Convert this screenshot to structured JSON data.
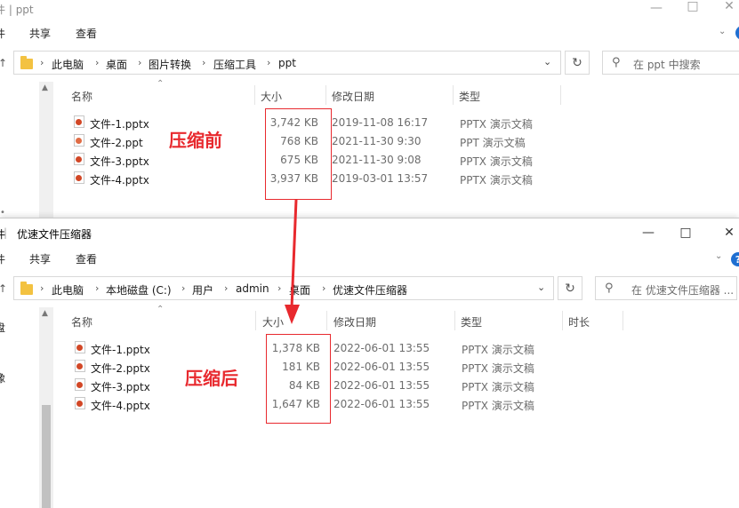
{
  "top_window": {
    "title": "ppt",
    "ribbon_tabs": [
      "件",
      "共享",
      "查看"
    ],
    "breadcrumb": [
      "此电脑",
      "桌面",
      "图片转换",
      "压缩工具",
      "ppt"
    ],
    "search_placeholder": "在 ppt 中搜索",
    "columns": [
      "名称",
      "大小",
      "修改日期",
      "类型"
    ],
    "files": [
      {
        "name": "文件-1.pptx",
        "size": "3,742 KB",
        "date": "2019-11-08 16:17",
        "type": "PPTX 演示文稿",
        "icon": "pptx-file-icon"
      },
      {
        "name": "文件-2.ppt",
        "size": "768 KB",
        "date": "2021-11-30 9:30",
        "type": "PPT 演示文稿",
        "icon": "ppt-file-icon"
      },
      {
        "name": "文件-3.pptx",
        "size": "675 KB",
        "date": "2021-11-30 9:08",
        "type": "PPTX 演示文稿",
        "icon": "pptx-file-icon"
      },
      {
        "name": "文件-4.pptx",
        "size": "3,937 KB",
        "date": "2019-03-01 13:57",
        "type": "PPTX 演示文稿",
        "icon": "pptx-file-icon"
      }
    ],
    "annotation": "压缩前"
  },
  "bottom_window": {
    "title": "优速文件压缩器",
    "title_prefix": "件",
    "ribbon_tabs": [
      "件",
      "共享",
      "查看"
    ],
    "breadcrumb": [
      "此电脑",
      "本地磁盘 (C:)",
      "用户",
      "admin",
      "桌面",
      "优速文件压缩器"
    ],
    "search_placeholder": "在 优速文件压缩器 ...",
    "columns": [
      "名称",
      "大小",
      "修改日期",
      "类型",
      "时长"
    ],
    "files": [
      {
        "name": "文件-1.pptx",
        "size": "1,378 KB",
        "date": "2022-06-01 13:55",
        "type": "PPTX 演示文稿"
      },
      {
        "name": "文件-2.pptx",
        "size": "181 KB",
        "date": "2022-06-01 13:55",
        "type": "PPTX 演示文稿"
      },
      {
        "name": "文件-3.pptx",
        "size": "84 KB",
        "date": "2022-06-01 13:55",
        "type": "PPTX 演示文稿"
      },
      {
        "name": "文件-4.pptx",
        "size": "1,647 KB",
        "date": "2022-06-01 13:55",
        "type": "PPTX 演示文稿"
      }
    ],
    "sidebar_fragments": [
      "盘",
      "像"
    ],
    "annotation": "压缩后"
  },
  "accent": {
    "annotation_red": "#e8292e",
    "folder_yellow": "#f3c241",
    "help_blue": "#1f6fd1"
  }
}
